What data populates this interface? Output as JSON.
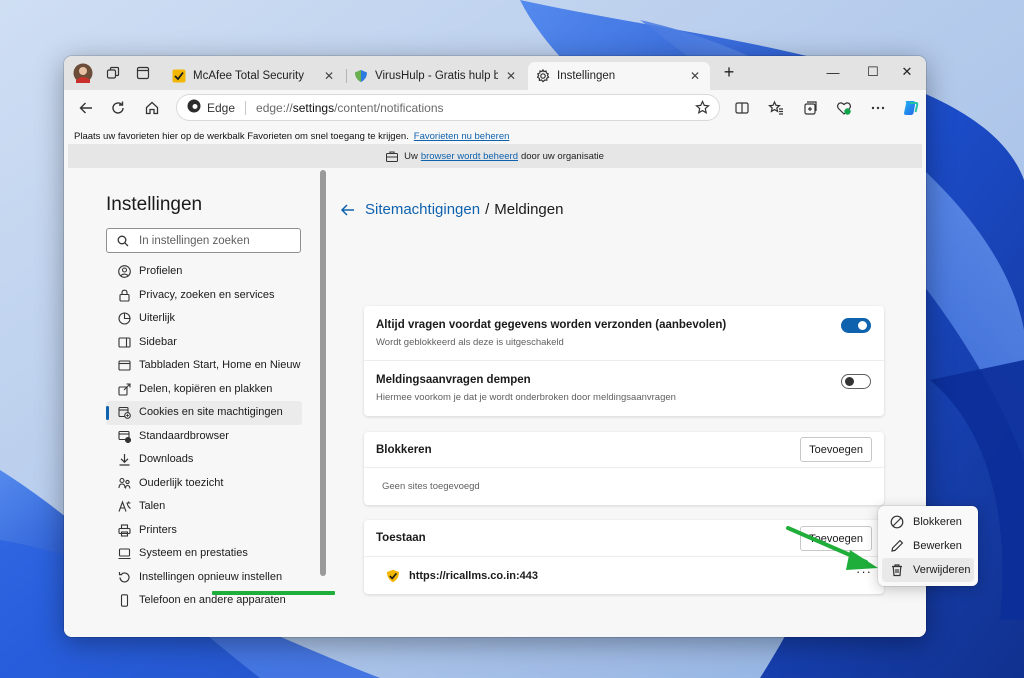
{
  "tabs": [
    {
      "title": "McAfee Total Security",
      "close": "✕",
      "favicon": "mcafee-check-icon",
      "active": false
    },
    {
      "title": "VirusHulp - Gratis hulp bij virusse",
      "close": "✕",
      "favicon": "virushulp-icon",
      "active": false
    },
    {
      "title": "Instellingen",
      "close": "✕",
      "favicon": "gear-icon",
      "active": true
    }
  ],
  "window_controls": {
    "new_tab": "+",
    "minimize": "—",
    "maximize": "☐",
    "close": "✕"
  },
  "address_bar": {
    "product": "Edge",
    "url_prefix": "edge://",
    "url_host": "settings",
    "url_path": "/content/notifications"
  },
  "favorites_bar": {
    "text": "Plaats uw favorieten hier op de werkbalk Favorieten om snel toegang te krijgen.",
    "link": "Favorieten nu beheren"
  },
  "managed_bar": {
    "prefix": "Uw",
    "link": "browser wordt beheerd",
    "suffix": "door uw organisatie"
  },
  "sidebar": {
    "title": "Instellingen",
    "search_placeholder": "In instellingen zoeken",
    "items": [
      {
        "label": "Profielen",
        "icon": "profile-icon"
      },
      {
        "label": "Privacy, zoeken en services",
        "icon": "lock-icon"
      },
      {
        "label": "Uiterlijk",
        "icon": "appearance-icon"
      },
      {
        "label": "Sidebar",
        "icon": "sidebar-icon"
      },
      {
        "label": "Tabbladen Start, Home en Nieuw",
        "icon": "start-tab-icon"
      },
      {
        "label": "Delen, kopiëren en plakken",
        "icon": "share-icon"
      },
      {
        "label": "Cookies en site machtigingen",
        "icon": "cookie-permissions-icon",
        "active": true
      },
      {
        "label": "Standaardbrowser",
        "icon": "default-browser-icon"
      },
      {
        "label": "Downloads",
        "icon": "download-icon"
      },
      {
        "label": "Ouderlijk toezicht",
        "icon": "family-icon"
      },
      {
        "label": "Talen",
        "icon": "language-icon"
      },
      {
        "label": "Printers",
        "icon": "printer-icon"
      },
      {
        "label": "Systeem en prestaties",
        "icon": "system-icon"
      },
      {
        "label": "Instellingen opnieuw instellen",
        "icon": "reset-icon"
      },
      {
        "label": "Telefoon en andere apparaten",
        "icon": "phone-icon"
      }
    ]
  },
  "main": {
    "breadcrumb_parent": "Sitemachtigingen",
    "breadcrumb_sep": "/",
    "breadcrumb_current": "Meldingen",
    "settings": [
      {
        "title": "Altijd vragen voordat gegevens worden verzonden (aanbevolen)",
        "desc": "Wordt geblokkeerd als deze is uitgeschakeld",
        "enabled": true
      },
      {
        "title": "Meldingsaanvragen dempen",
        "desc": "Hiermee voorkom je dat je wordt onderbroken door meldingsaanvragen",
        "enabled": false
      }
    ],
    "block": {
      "title": "Blokkeren",
      "add_label": "Toevoegen",
      "empty_text": "Geen sites toegevoegd"
    },
    "allow": {
      "title": "Toestaan",
      "add_label": "Toevoegen",
      "sites": [
        {
          "url": "https://ricallms.co.in:443",
          "favicon": "mcafee-check-icon",
          "more": "···"
        }
      ]
    }
  },
  "context_menu": {
    "items": [
      {
        "label": "Blokkeren",
        "icon": "block-icon"
      },
      {
        "label": "Bewerken",
        "icon": "edit-pencil-icon"
      },
      {
        "label": "Verwijderen",
        "icon": "trash-icon",
        "highlighted": true
      }
    ]
  },
  "colors": {
    "accent": "#0f62ae",
    "annotation_green": "#1fae3a",
    "mcafee_yellow": "#f2b705"
  }
}
